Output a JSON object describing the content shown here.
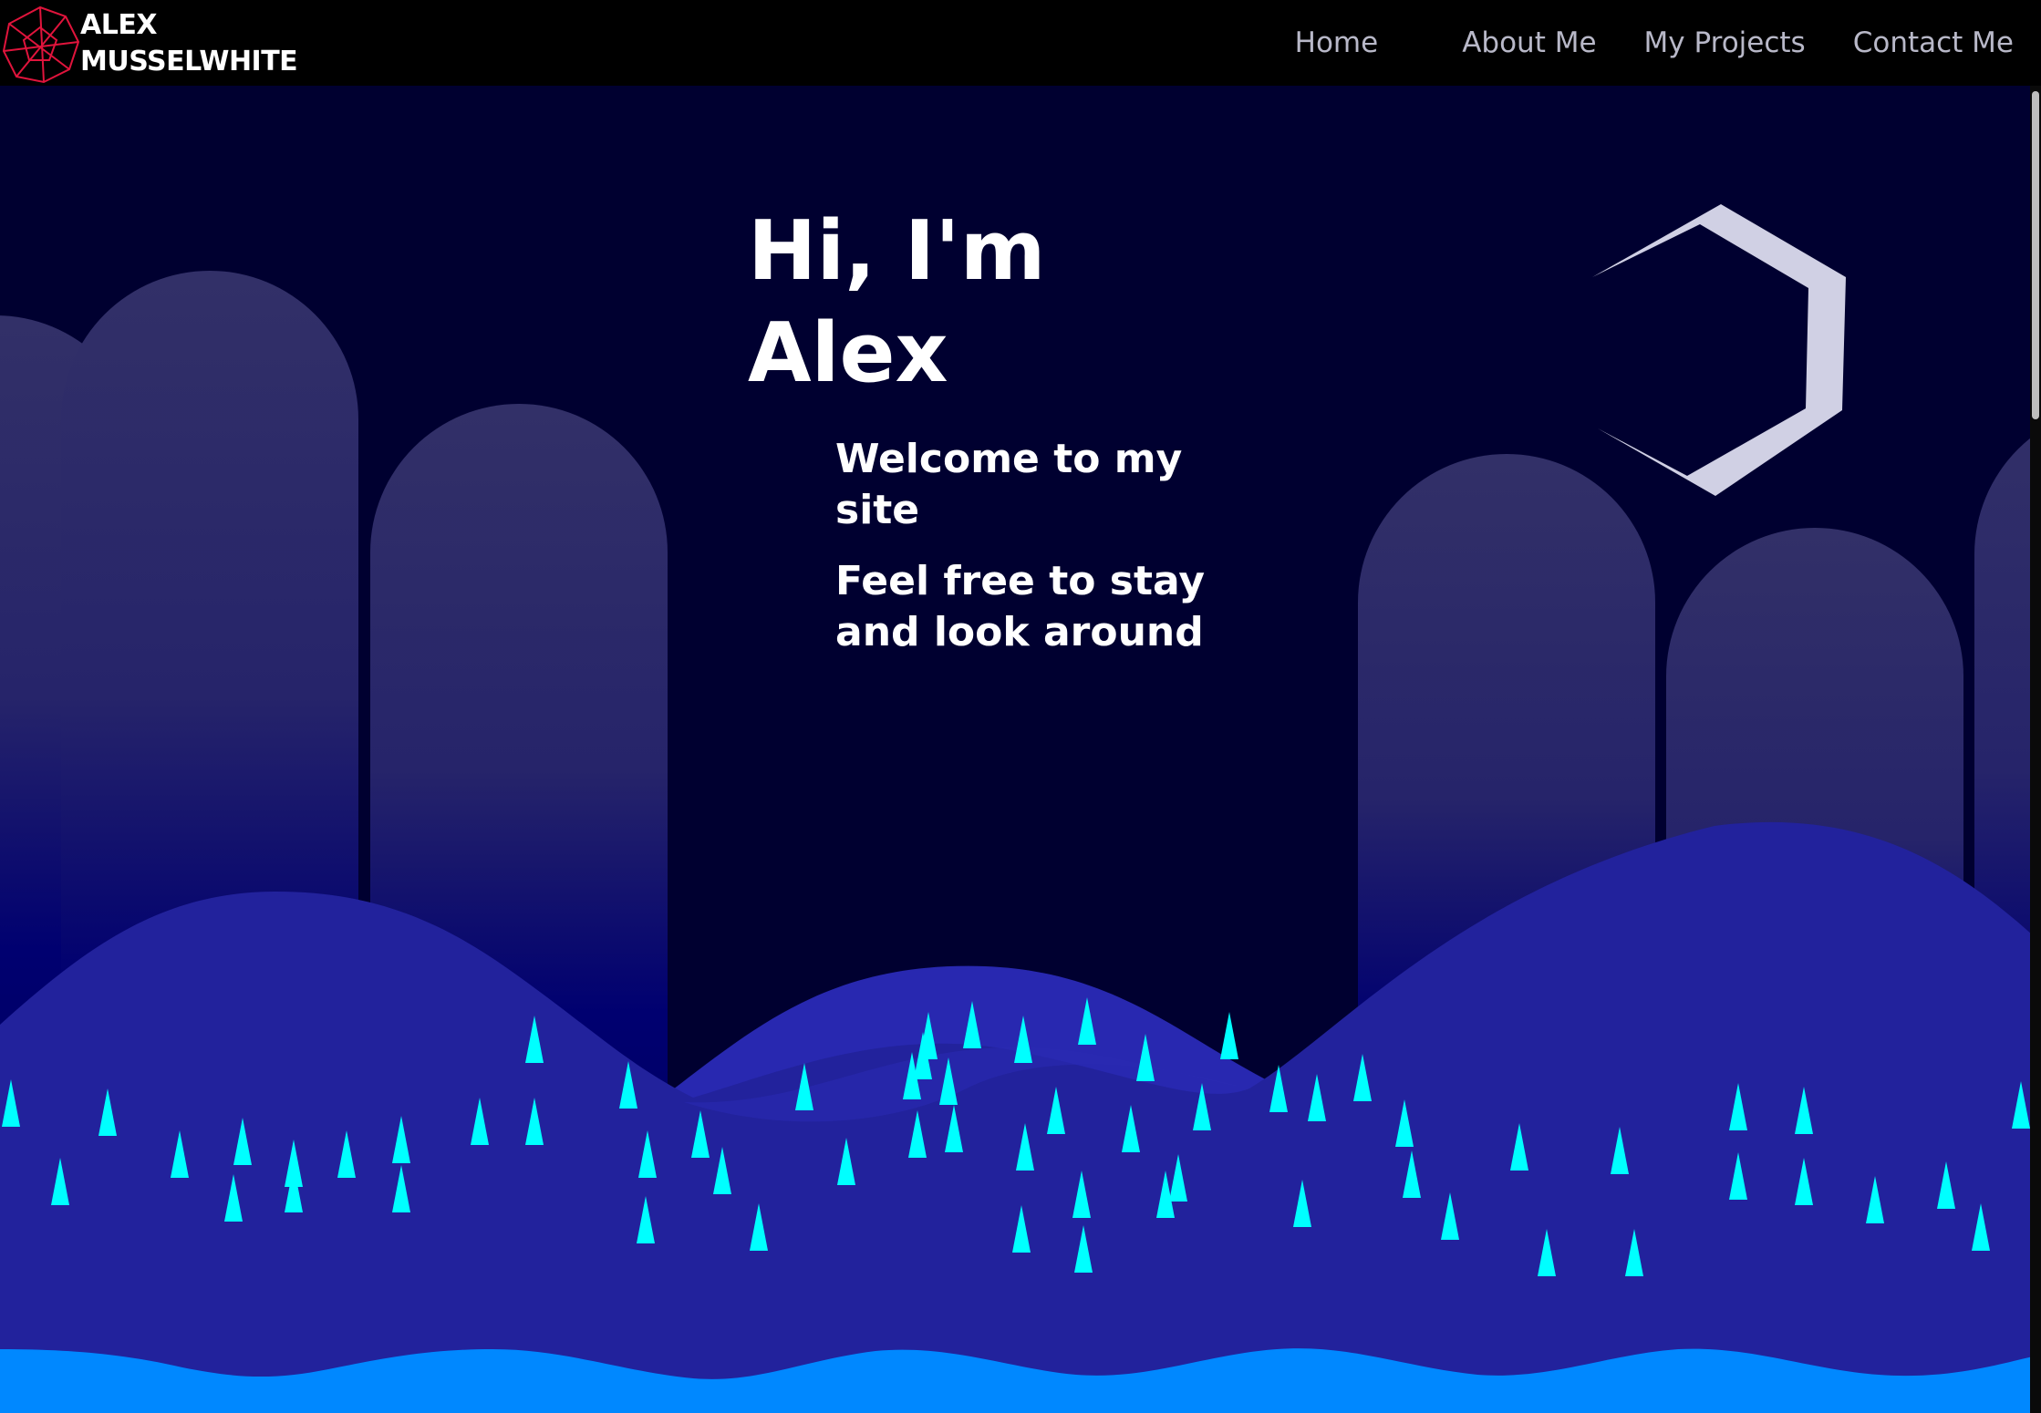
{
  "logo": {
    "line1": "ALEX",
    "line2": "MUSSELWHITE",
    "mark_icon": "polygon-network-icon",
    "mark_color": "#e0143c"
  },
  "nav": {
    "items": [
      {
        "label": "Home"
      },
      {
        "label": "About Me"
      },
      {
        "label": "My Projects"
      },
      {
        "label": "Contact Me"
      }
    ]
  },
  "hero": {
    "title_line1": "Hi, I'm",
    "title_line2": "Alex",
    "subtitle_line1": "Welcome to my site",
    "subtitle_line2": "Feel free to stay and look around"
  },
  "decoration": {
    "hexagon_icon": "hexagon-outline-icon",
    "rain_icon": "raindrop-icon"
  },
  "colors": {
    "navbar_bg": "#000000",
    "sky": "#000030",
    "pillar_top": "#323068",
    "pillar_bottom": "#000070",
    "hills": "#22229c",
    "mid_hill": "#2828b0",
    "raindrops": "#00ffff",
    "water": "#0088ff",
    "hexagon": "#d0d0e4",
    "text": "#ffffff",
    "nav_text": "#b8b8c8"
  }
}
